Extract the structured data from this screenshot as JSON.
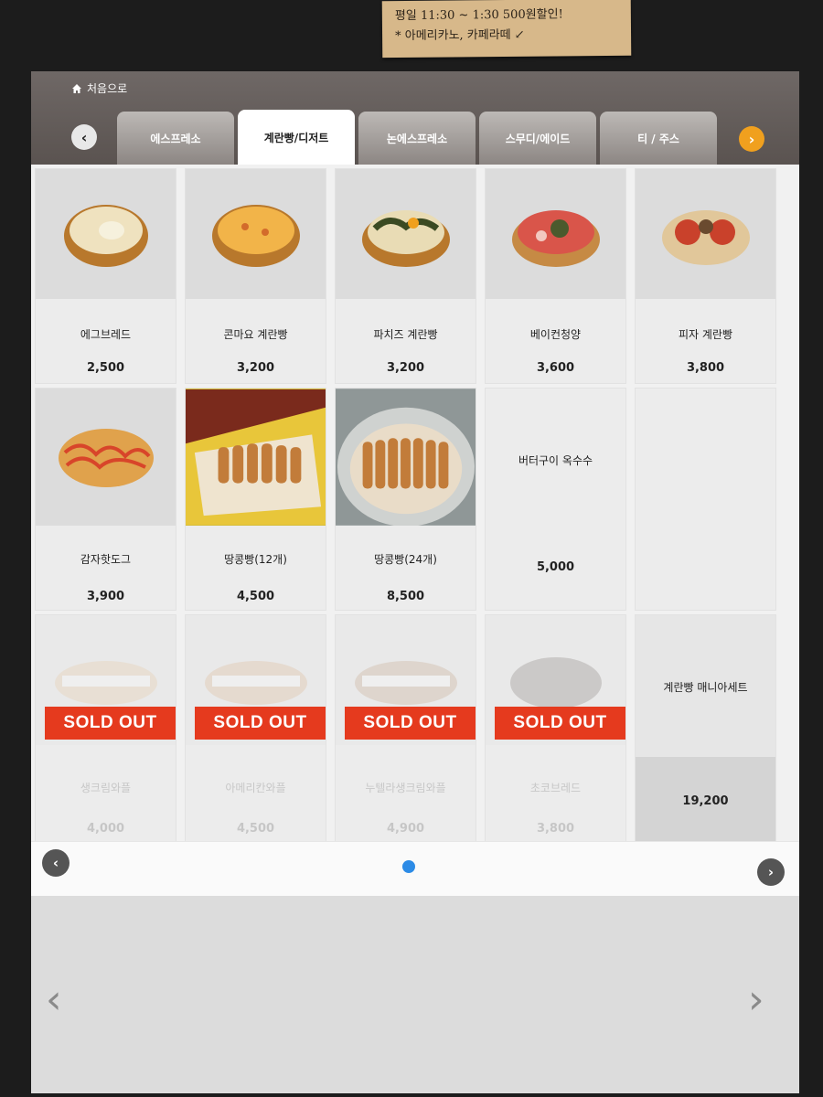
{
  "note": {
    "line1": "평일 11:30 ~ 1:30 500원할인!",
    "line2": "* 아메리카노, 카페라떼 ↙"
  },
  "header": {
    "home_label": "처음으로"
  },
  "tabs": [
    {
      "label": "에스프레소"
    },
    {
      "label": "계란빵/디저트"
    },
    {
      "label": "논에스프레소"
    },
    {
      "label": "스무디/에이드"
    },
    {
      "label": "티 / 주스"
    }
  ],
  "products": [
    {
      "name": "에그브레드",
      "price": "2,500"
    },
    {
      "name": "콘마요 계란빵",
      "price": "3,200"
    },
    {
      "name": "파치즈 계란빵",
      "price": "3,200"
    },
    {
      "name": "베이컨청양",
      "price": "3,600"
    },
    {
      "name": "피자 계란빵",
      "price": "3,800"
    },
    {
      "name": "감자핫도그",
      "price": "3,900"
    },
    {
      "name": "땅콩빵(12개)",
      "price": "4,500"
    },
    {
      "name": "땅콩빵(24개)",
      "price": "8,500"
    },
    {
      "name": "버터구이 옥수수",
      "price": "5,000"
    },
    {
      "name": "",
      "price": ""
    },
    {
      "name": "생크림와플",
      "price": "4,000",
      "badge": "SOLD OUT"
    },
    {
      "name": "아메리칸와플",
      "price": "4,500",
      "badge": "SOLD OUT"
    },
    {
      "name": "누텔라생크림와플",
      "price": "4,900",
      "badge": "SOLD OUT"
    },
    {
      "name": "초코브레드",
      "price": "3,800",
      "badge": "SOLD OUT"
    },
    {
      "name": "계란빵 매니아세트",
      "price": "19,200"
    }
  ],
  "colors": {
    "accent_orange": "#f0a01e",
    "sold_out_red": "#e53a1e",
    "page_dot_blue": "#2c8be6"
  },
  "icons": {
    "home": "home-icon",
    "tab_prev": "chevron-left-icon",
    "tab_next": "chevron-right-icon"
  }
}
